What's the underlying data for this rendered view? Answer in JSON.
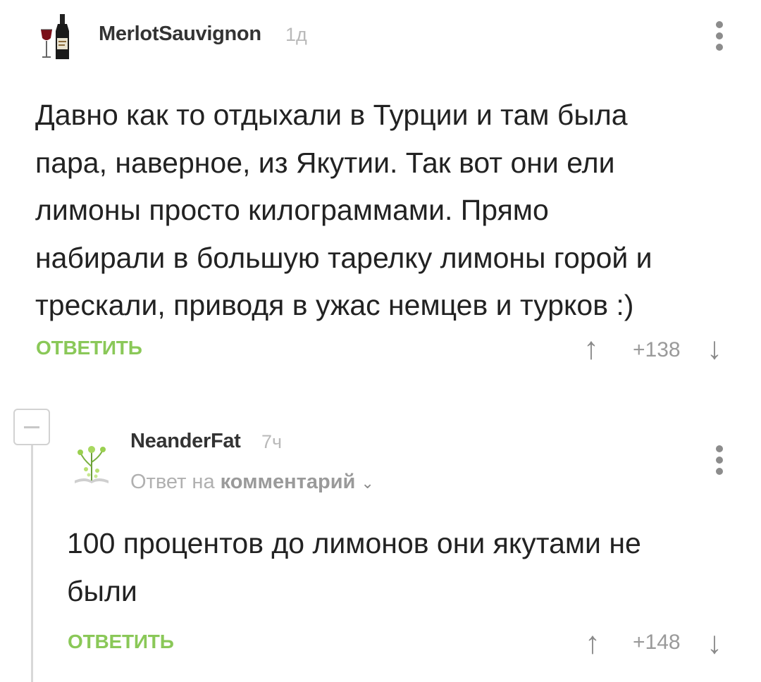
{
  "comments": [
    {
      "username": "MerlotSauvignon",
      "time": "1д",
      "avatar_icon": "wine-bottle-and-glass-icon",
      "lines": [
        "Давно как то отдыхали в Турции и там была",
        "пара, наверное, из Якутии. Так вот они ели",
        "лимоны просто килограммами. Прямо",
        "набирали в большую тарелку лимоны горой и",
        "трескали, приводя в ужас немцев и турков :)"
      ],
      "reply_label": "ОТВЕТИТЬ",
      "rating": "+138"
    },
    {
      "username": "NeanderFat",
      "time": "7ч",
      "avatar_icon": "plant-on-book-icon",
      "reply_to_prefix": "Ответ на",
      "reply_to_link": "комментарий",
      "lines": [
        "100 процентов до лимонов они якутами не",
        "были"
      ],
      "reply_label": "ОТВЕТИТЬ",
      "rating": "+148"
    }
  ],
  "icons": {
    "upvote": "↑",
    "downvote": "↓",
    "chevron": "⌄"
  },
  "colors": {
    "accent_green": "#8ac858",
    "muted_gray": "#b0b0b0"
  }
}
